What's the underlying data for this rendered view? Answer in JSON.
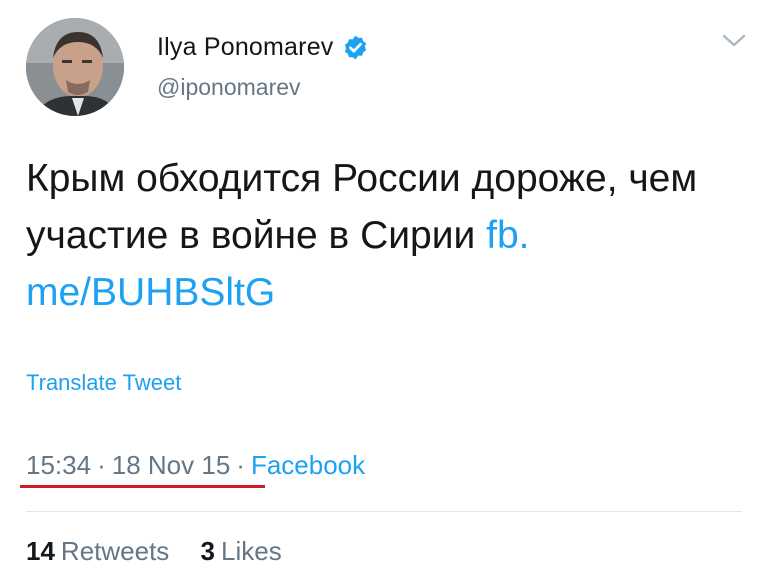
{
  "user": {
    "display_name": "Ilya Ponomarev",
    "handle": "@iponomarev",
    "verified": true,
    "avatar_icon": "profile-photo"
  },
  "menu": {
    "icon": "chevron-down-icon"
  },
  "tweet": {
    "text": "Крым обходится России дороже, чем участие в войне в Сирии ",
    "link": "fb.\nme/BUHBSltG",
    "translate_label": "Translate Tweet",
    "time": "15:34",
    "date": "18 Nov 15",
    "separator": "·",
    "source": "Facebook"
  },
  "stats": {
    "retweets_count": "14",
    "retweets_label": "Retweets",
    "likes_count": "3",
    "likes_label": "Likes"
  },
  "colors": {
    "link_blue": "#1da1f2",
    "secondary_gray": "#657786",
    "highlight_red": "#d11c2b",
    "text_dark": "#14171a"
  }
}
